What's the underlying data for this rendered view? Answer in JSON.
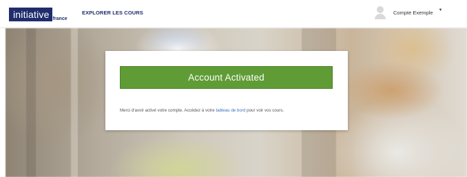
{
  "header": {
    "logo_main": "initiative",
    "logo_sub": "france",
    "nav_explore": "EXPLORER LES COURS",
    "user_name": "Compte Exemple",
    "user_caret": "▼"
  },
  "card": {
    "banner_text": "Account Activated",
    "message_before": "Merci d'avoir activé votre compte. Accédez à votre ",
    "message_link": "tableau de bord",
    "message_after": " pour voir vos cours."
  },
  "colors": {
    "brand_navy": "#1f2d6d",
    "success_green": "#5f9c35",
    "link_blue": "#3b73b9"
  }
}
